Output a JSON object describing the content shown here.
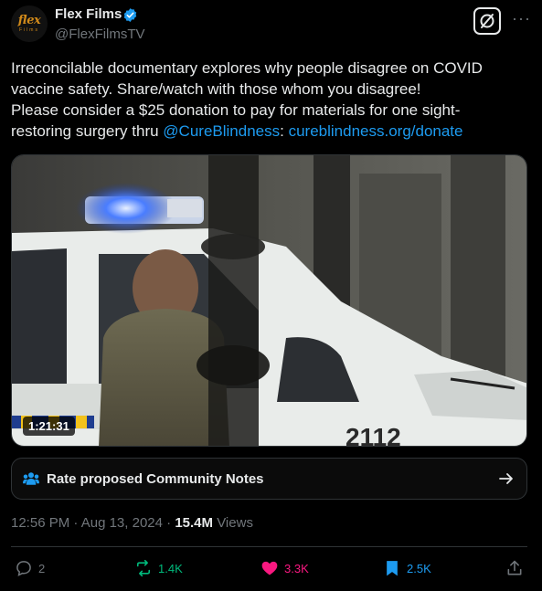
{
  "author": {
    "name": "Flex Films",
    "handle": "@FlexFilmsTV",
    "avatar_logo": "flex",
    "avatar_sub": "Films"
  },
  "tweet": {
    "line1": "Irreconcilable documentary explores why people disagree on COVID",
    "line2": "vaccine safety. Share/watch with those whom you disagree!",
    "line3": "Please consider a $25 donation to pay for materials for one sight-",
    "line4_prefix": "restoring surgery thru ",
    "mention": "@CureBlindness",
    "colon": ": ",
    "link": "cureblindness.org/donate"
  },
  "media": {
    "duration": "1:21:31",
    "car_number": "2112"
  },
  "community_notes": {
    "label": "Rate proposed Community Notes"
  },
  "meta": {
    "time": "12:56 PM",
    "date": "Aug 13, 2024",
    "views_count": "15.4M",
    "views_label": "Views"
  },
  "actions": {
    "replies": "2",
    "reposts": "1.4K",
    "likes": "3.3K",
    "bookmarks": "2.5K"
  },
  "colors": {
    "accent": "#1d9bf0",
    "repost": "#00ba7c",
    "like": "#f91880",
    "bookmark": "#1d9bf0"
  }
}
